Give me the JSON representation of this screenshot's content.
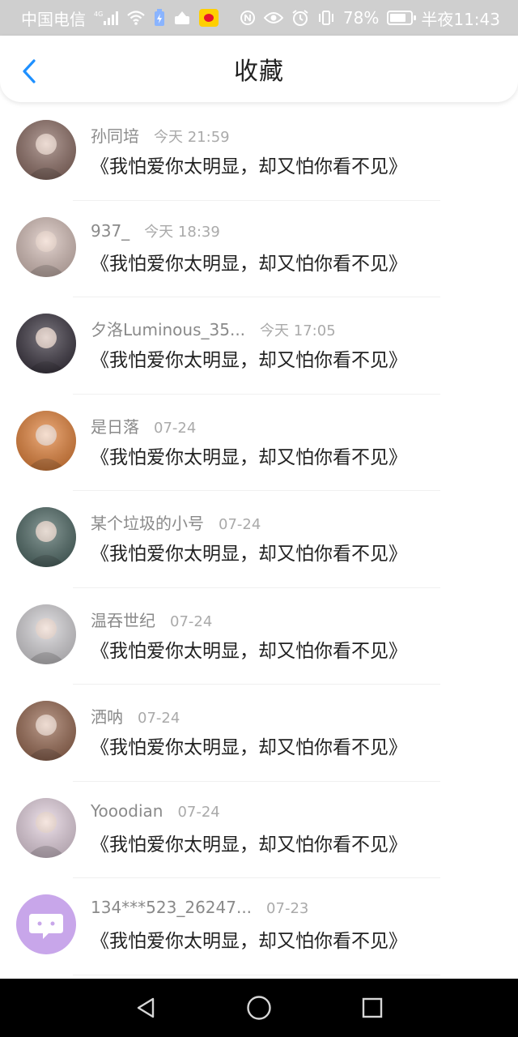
{
  "status_bar": {
    "carrier": "中国电信",
    "network": "4G",
    "battery": "78%",
    "battery_level": 0.78,
    "time": "半夜11:43"
  },
  "header": {
    "title": "收藏"
  },
  "favorites": [
    {
      "name": "孙同培",
      "time": "今天 21:59",
      "content": "《我怕爱你太明显，却又怕你看不见》",
      "avatar_color": "#8f6f66"
    },
    {
      "name": "937_",
      "time": "今天 18:39",
      "content": "《我怕爱你太明显，却又怕你看不见》",
      "avatar_color": "#d9c2bb"
    },
    {
      "name": "夕洛Luminous_35...",
      "time": "今天 17:05",
      "content": "《我怕爱你太明显，却又怕你看不见》",
      "avatar_color": "#3a3440"
    },
    {
      "name": "是日落",
      "time": "07-24",
      "content": "《我怕爱你太明显，却又怕你看不见》",
      "avatar_color": "#e8843a"
    },
    {
      "name": "某个垃圾的小号",
      "time": "07-24",
      "content": "《我怕爱你太明显，却又怕你看不见》",
      "avatar_color": "#4f6a66"
    },
    {
      "name": "温吞世纪",
      "time": "07-24",
      "content": "《我怕爱你太明显，却又怕你看不见》",
      "avatar_color": "#d8d6da"
    },
    {
      "name": "洒呐",
      "time": "07-24",
      "content": "《我怕爱你太明显，却又怕你看不见》",
      "avatar_color": "#9a6a52"
    },
    {
      "name": "Yooodian",
      "time": "07-24",
      "content": "《我怕爱你太明显，却又怕你看不见》",
      "avatar_color": "#e9d6e4"
    },
    {
      "name": "134***523_26247...",
      "time": "07-23",
      "content": "《我怕爱你太明显，却又怕你看不见》",
      "avatar_color": "#c8a6ea"
    }
  ],
  "nav": {
    "back_icon": "triangle-back-icon",
    "home_icon": "circle-home-icon",
    "recents_icon": "square-recents-icon"
  }
}
